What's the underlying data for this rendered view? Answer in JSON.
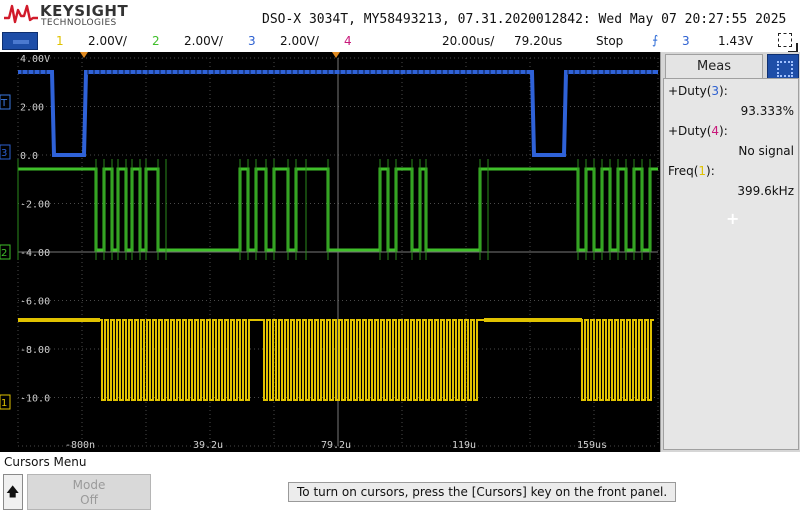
{
  "brand": {
    "name": "KEYSIGHT",
    "sub": "TECHNOLOGIES"
  },
  "title": "DSO-X 3034T, MY58493213, 07.31.2020012842: Wed May 07 20:27:55 2025",
  "channels": [
    {
      "num": "1",
      "scale": "2.00V/",
      "color": "#e0c200"
    },
    {
      "num": "2",
      "scale": "2.00V/",
      "color": "#3fbf2a"
    },
    {
      "num": "3",
      "scale": "2.00V/",
      "color": "#2b5fd0"
    },
    {
      "num": "4",
      "scale": "",
      "color": "#c8187a"
    }
  ],
  "timebase": {
    "scale": "20.00us/",
    "delay": "79.20us",
    "run_state": "Stop"
  },
  "trigger": {
    "source": "3",
    "level": "1.43V"
  },
  "y_labels": [
    "4.00V",
    "2.00",
    "0.0",
    "-2.00",
    "-4.00",
    "-6.00",
    "-8.00",
    "-10.0"
  ],
  "x_labels": [
    "-800n",
    "39.2u",
    "79.2u",
    "119u",
    "159us"
  ],
  "markers": {
    "trigger": "T",
    "ch3": "3",
    "ch2": "2",
    "ch1": "1"
  },
  "meas_panel": {
    "tab": "Meas",
    "items": [
      {
        "label_prefix": "+Duty(",
        "channel": "3",
        "label_suffix": "):",
        "value": "93.333%"
      },
      {
        "label_prefix": "+Duty(",
        "channel": "4",
        "label_suffix": "):",
        "value": "No signal"
      },
      {
        "label_prefix": "Freq(",
        "channel": "1",
        "label_suffix": "):",
        "value": "399.6kHz"
      }
    ],
    "add_symbol": "+"
  },
  "bottom": {
    "menu_title": "Cursors Menu",
    "mode_label": "Mode",
    "mode_value": "Off",
    "hint": "To turn on cursors, press the [Cursors] key on the front panel."
  },
  "colors": {
    "ch1": "#e0c200",
    "ch2": "#3fbf2a",
    "ch3": "#2b5fd0",
    "ch4": "#c8187a",
    "grid": "#5a5a5a",
    "background": "#000000",
    "ch3_trace": "#2f62d8"
  }
}
